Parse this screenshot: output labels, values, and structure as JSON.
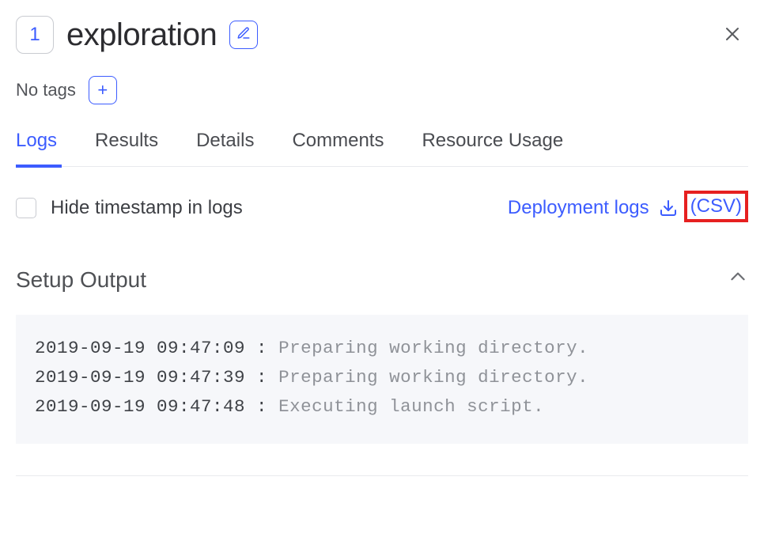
{
  "header": {
    "badge_number": "1",
    "title": "exploration",
    "edit_icon": "pencil-icon",
    "close_icon": "close-icon"
  },
  "tags": {
    "label": "No tags",
    "add_icon": "plus-icon"
  },
  "tabs": [
    {
      "id": "logs",
      "label": "Logs",
      "active": true
    },
    {
      "id": "results",
      "label": "Results",
      "active": false
    },
    {
      "id": "details",
      "label": "Details",
      "active": false
    },
    {
      "id": "comments",
      "label": "Comments",
      "active": false
    },
    {
      "id": "resource-usage",
      "label": "Resource Usage",
      "active": false
    }
  ],
  "controls": {
    "hide_timestamp_label": "Hide timestamp in logs",
    "deployment_logs_label": "Deployment logs",
    "download_icon": "download-icon",
    "csv_label": "(CSV)"
  },
  "section": {
    "title": "Setup Output",
    "collapse_icon": "chevron-up-icon",
    "logs": [
      {
        "timestamp": "2019-09-19 09:47:09",
        "separator": " : ",
        "message": "Preparing working directory."
      },
      {
        "timestamp": "2019-09-19 09:47:39",
        "separator": " : ",
        "message": "Preparing working directory."
      },
      {
        "timestamp": "2019-09-19 09:47:48",
        "separator": " : ",
        "message": "Executing launch script."
      }
    ]
  }
}
